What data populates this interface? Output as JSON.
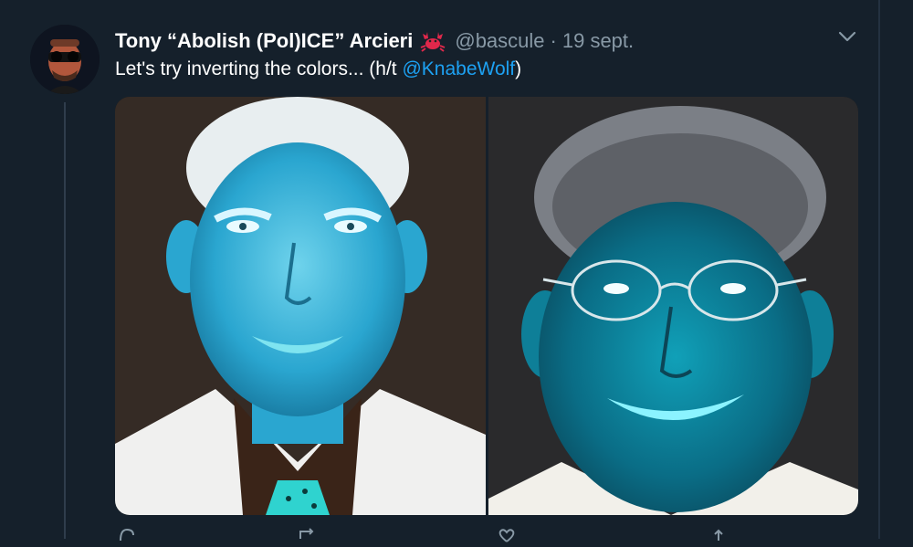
{
  "tweet": {
    "display_name": "Tony “Abolish (Pol)ICE” Arcieri",
    "name_emoji": "crab-emoji",
    "handle": "@bascule",
    "separator": "·",
    "timestamp": "19 sept.",
    "text_before": "Let's try inverting the colors... (h/t ",
    "mention": "@KnabeWolf",
    "text_after": ")"
  },
  "icons": {
    "menu": "chevron-down-icon",
    "reply": "reply-icon",
    "retweet": "retweet-icon",
    "like": "heart-icon",
    "share": "share-icon"
  },
  "colors": {
    "background": "#15202b",
    "mention": "#1da1f2",
    "muted": "#8899a6"
  }
}
